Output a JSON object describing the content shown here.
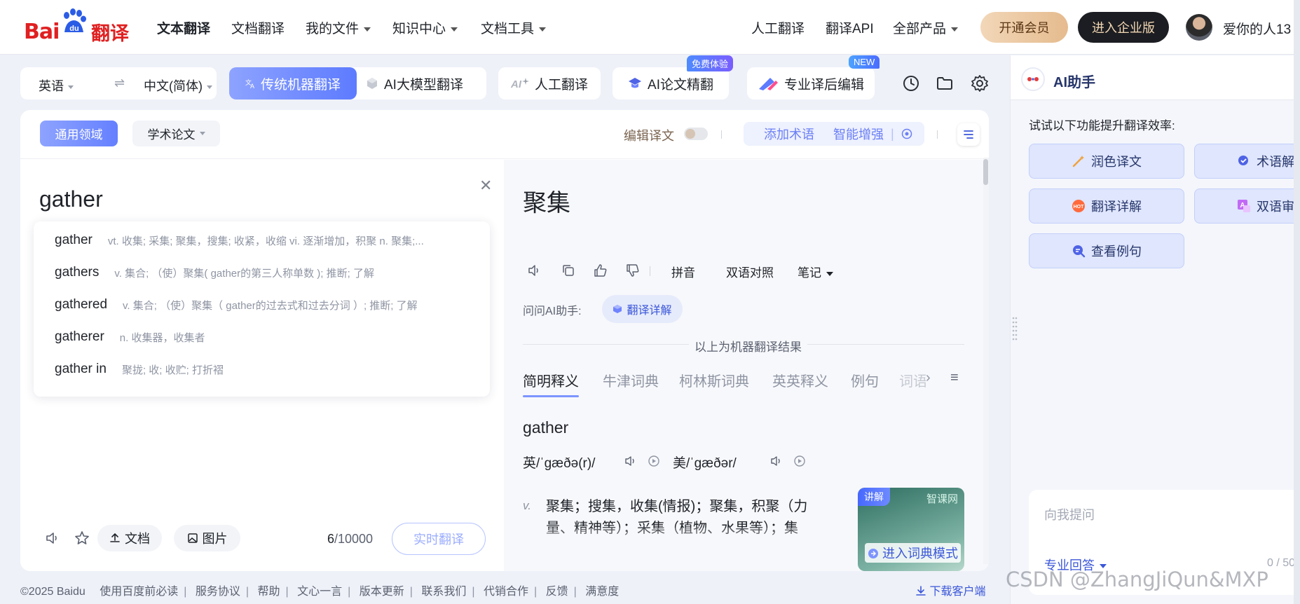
{
  "brand": {
    "logo_left": "Bai",
    "logo_mid": "du",
    "logo_right": "翻译"
  },
  "nav": {
    "items": [
      {
        "label": "文本翻译",
        "active": true
      },
      {
        "label": "文档翻译"
      },
      {
        "label": "我的文件",
        "dropdown": true
      },
      {
        "label": "知识中心",
        "dropdown": true
      },
      {
        "label": "文档工具",
        "dropdown": true
      }
    ],
    "right_items": [
      {
        "label": "人工翻译"
      },
      {
        "label": "翻译API"
      },
      {
        "label": "全部产品",
        "dropdown": true
      }
    ],
    "vip_button": "开通会员",
    "enterprise_button": "进入企业版",
    "username": "爱你的人13"
  },
  "toolbar": {
    "source_lang": "英语",
    "target_lang": "中文(简体)",
    "mode_traditional": "传统机器翻译",
    "mode_ai": "AI大模型翻译",
    "human_translation": "人工翻译",
    "ai_paper": "AI论文精翻",
    "ai_paper_badge": "免费体验",
    "post_edit": "专业译后编辑",
    "post_edit_badge": "NEW"
  },
  "card_header": {
    "domain_general": "通用领域",
    "domain_academic": "学术论文",
    "edit_translation": "编辑译文",
    "add_term": "添加术语",
    "smart_enhance": "智能增强"
  },
  "source": {
    "text": "gather",
    "suggestions": [
      {
        "word": "gather",
        "def": "vt. 收集; 采集; 聚集，搜集; 收紧，收缩 vi. 逐渐增加，积聚 n. 聚集;..."
      },
      {
        "word": "gathers",
        "def": "v. 集合; （使）聚集( gather的第三人称单数 ); 推断; 了解"
      },
      {
        "word": "gathered",
        "def": "v. 集合; （使）聚集（ gather的过去式和过去分词 ）; 推断; 了解"
      },
      {
        "word": "gatherer",
        "def": "n. 收集器，收集者"
      },
      {
        "word": "gather in",
        "def": "聚拢; 收; 收贮; 打折褶"
      }
    ],
    "doc_button": "文档",
    "image_button": "图片",
    "char_count": "6",
    "char_max": "/10000",
    "realtime_button": "实时翻译"
  },
  "target": {
    "text": "聚集",
    "pinyin": "拼音",
    "bilingual": "双语对照",
    "notes": "笔记",
    "ask_ai_label": "问问AI助手:",
    "ask_ai_chip": "翻译详解",
    "machine_result_label": "以上为机器翻译结果",
    "dict_tabs": [
      "简明释义",
      "牛津词典",
      "柯林斯词典",
      "英英释义",
      "例句",
      "词语"
    ],
    "dict_word": "gather",
    "phonetic_uk": "英/ˈɡæðə(r)/",
    "phonetic_us": "美/ˈɡæðər/",
    "pos": "v.",
    "sense": "聚集；搜集，收集(情报)；聚集，积聚（力量、精神等）；采集（植物、水果等）；集",
    "video_tag": "讲解",
    "video_brand": "智课网",
    "video_link": "进入词典模式"
  },
  "footer": {
    "copyright": "©2025 Baidu",
    "links": [
      "使用百度前必读",
      "服务协议",
      "帮助",
      "文心一言",
      "版本更新",
      "联系我们",
      "代销合作",
      "反馈",
      "满意度"
    ],
    "download": "下载客户端"
  },
  "ai_panel": {
    "title": "AI助手",
    "hint": "试试以下功能提升翻译效率:",
    "buttons": [
      "润色译文",
      "术语解",
      "翻译详解",
      "双语审",
      "查看例句"
    ],
    "input_placeholder": "向我提问",
    "pro_answer": "专业回答",
    "count": "0 / 50"
  },
  "watermark": "CSDN @ZhangJiQun&MXP",
  "colors": {
    "brand_red": "#e02021",
    "accent_blue": "#5d7bff",
    "link_blue": "#3a56d9"
  }
}
